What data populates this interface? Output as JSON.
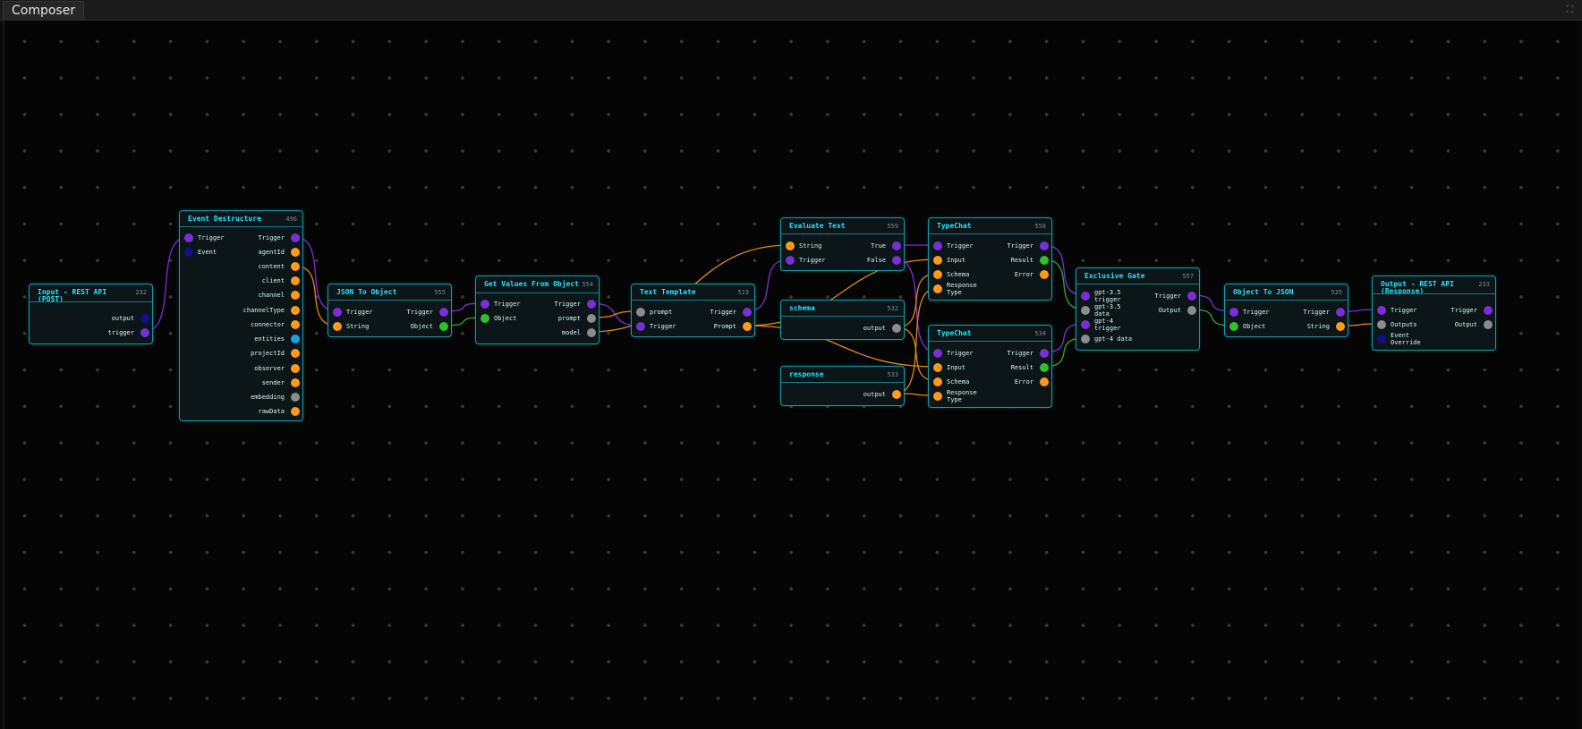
{
  "app": {
    "tab_label": "Composer",
    "maximize_icon": "expand-icon"
  },
  "colors": {
    "trigger": "#7a2fd6",
    "event": "#10108a",
    "string": "#ff9a1a",
    "object": "#2fbf2f",
    "any": "#8c8c8c",
    "entities": "#1f9fe0",
    "wire_orange": "#e08a14",
    "wire_purple": "#7a2fd6",
    "wire_green": "#2fa82f"
  },
  "nodes": [
    {
      "key": "input-rest",
      "title": "Input - REST API\n(POST)",
      "id": "232",
      "inputs": [],
      "outputs": [
        {
          "label": "output",
          "type": "event"
        },
        {
          "label": "trigger",
          "type": "trigger"
        }
      ]
    },
    {
      "key": "event-destructure",
      "title": "Event Destructure",
      "id": "496",
      "inputs": [
        {
          "label": "Trigger",
          "type": "trigger"
        },
        {
          "label": "Event",
          "type": "event"
        }
      ],
      "outputs": [
        {
          "label": "Trigger",
          "type": "trigger"
        },
        {
          "label": "agentId",
          "type": "string"
        },
        {
          "label": "content",
          "type": "string"
        },
        {
          "label": "client",
          "type": "string"
        },
        {
          "label": "channel",
          "type": "string"
        },
        {
          "label": "channelType",
          "type": "string"
        },
        {
          "label": "connector",
          "type": "string"
        },
        {
          "label": "entities",
          "type": "entities"
        },
        {
          "label": "projectId",
          "type": "string"
        },
        {
          "label": "observer",
          "type": "string"
        },
        {
          "label": "sender",
          "type": "string"
        },
        {
          "label": "embedding",
          "type": "any"
        },
        {
          "label": "rawData",
          "type": "string"
        }
      ]
    },
    {
      "key": "json-to-object",
      "title": "JSON To Object",
      "id": "555",
      "inputs": [
        {
          "label": "Trigger",
          "type": "trigger"
        },
        {
          "label": "String",
          "type": "string"
        }
      ],
      "outputs": [
        {
          "label": "Trigger",
          "type": "trigger"
        },
        {
          "label": "Object",
          "type": "object"
        }
      ]
    },
    {
      "key": "get-values",
      "title": "Get Values From Object",
      "id": "554",
      "inputs": [
        {
          "label": "Trigger",
          "type": "trigger"
        },
        {
          "label": "Object",
          "type": "object"
        }
      ],
      "outputs": [
        {
          "label": "Trigger",
          "type": "trigger"
        },
        {
          "label": "prompt",
          "type": "any"
        },
        {
          "label": "model",
          "type": "any"
        }
      ]
    },
    {
      "key": "text-template",
      "title": "Text Template",
      "id": "519",
      "inputs": [
        {
          "label": "prompt",
          "type": "any"
        },
        {
          "label": "Trigger",
          "type": "trigger"
        }
      ],
      "outputs": [
        {
          "label": "Trigger",
          "type": "trigger"
        },
        {
          "label": "Prompt",
          "type": "string"
        }
      ]
    },
    {
      "key": "evaluate-text",
      "title": "Evaluate Text",
      "id": "559",
      "inputs": [
        {
          "label": "String",
          "type": "string"
        },
        {
          "label": "Trigger",
          "type": "trigger"
        }
      ],
      "outputs": [
        {
          "label": "True",
          "type": "trigger"
        },
        {
          "label": "False",
          "type": "trigger"
        }
      ]
    },
    {
      "key": "schema",
      "title": "schema",
      "id": "532",
      "inputs": [],
      "outputs": [
        {
          "label": "output",
          "type": "any"
        }
      ]
    },
    {
      "key": "response",
      "title": "response",
      "id": "533",
      "inputs": [],
      "outputs": [
        {
          "label": "output",
          "type": "string"
        }
      ]
    },
    {
      "key": "typechat-1",
      "title": "TypeChat",
      "id": "558",
      "inputs": [
        {
          "label": "Trigger",
          "type": "trigger"
        },
        {
          "label": "Input",
          "type": "string"
        },
        {
          "label": "Schema",
          "type": "string"
        },
        {
          "label": "Response\nType",
          "type": "string"
        }
      ],
      "outputs": [
        {
          "label": "Trigger",
          "type": "trigger"
        },
        {
          "label": "Result",
          "type": "object"
        },
        {
          "label": "Error",
          "type": "string"
        }
      ]
    },
    {
      "key": "typechat-2",
      "title": "TypeChat",
      "id": "534",
      "inputs": [
        {
          "label": "Trigger",
          "type": "trigger"
        },
        {
          "label": "Input",
          "type": "string"
        },
        {
          "label": "Schema",
          "type": "string"
        },
        {
          "label": "Response\nType",
          "type": "string"
        }
      ],
      "outputs": [
        {
          "label": "Trigger",
          "type": "trigger"
        },
        {
          "label": "Result",
          "type": "object"
        },
        {
          "label": "Error",
          "type": "string"
        }
      ]
    },
    {
      "key": "exclusive-gate",
      "title": "Exclusive Gate",
      "id": "557",
      "inputs": [
        {
          "label": "gpt-3.5\ntrigger",
          "type": "trigger"
        },
        {
          "label": "gpt-3.5\ndata",
          "type": "any"
        },
        {
          "label": "gpt-4\ntrigger",
          "type": "trigger"
        },
        {
          "label": "gpt-4 data",
          "type": "any"
        }
      ],
      "outputs": [
        {
          "label": "Trigger",
          "type": "trigger"
        },
        {
          "label": "Output",
          "type": "any"
        }
      ]
    },
    {
      "key": "object-to-json",
      "title": "Object To JSON",
      "id": "535",
      "inputs": [
        {
          "label": "Trigger",
          "type": "trigger"
        },
        {
          "label": "Object",
          "type": "object"
        }
      ],
      "outputs": [
        {
          "label": "Trigger",
          "type": "trigger"
        },
        {
          "label": "String",
          "type": "string"
        }
      ]
    },
    {
      "key": "output-rest",
      "title": "Output - REST API\n(Response)",
      "id": "233",
      "inputs": [
        {
          "label": "Trigger",
          "type": "trigger"
        },
        {
          "label": "Outputs",
          "type": "any"
        },
        {
          "label": "Event\nOverride",
          "type": "event"
        }
      ],
      "outputs": [
        {
          "label": "Trigger",
          "type": "trigger"
        },
        {
          "label": "Output",
          "type": "any"
        }
      ]
    }
  ],
  "wires": [
    {
      "from": "input-rest.out.1",
      "to": "event-destructure.in.0",
      "color": "wire_purple"
    },
    {
      "from": "event-destructure.out.0",
      "to": "json-to-object.in.0",
      "color": "wire_purple"
    },
    {
      "from": "event-destructure.out.2",
      "to": "json-to-object.in.1",
      "color": "wire_orange"
    },
    {
      "from": "json-to-object.out.0",
      "to": "get-values.in.0",
      "color": "wire_purple"
    },
    {
      "from": "json-to-object.out.1",
      "to": "get-values.in.1",
      "color": "wire_green"
    },
    {
      "from": "get-values.out.0",
      "to": "text-template.in.1",
      "color": "wire_purple"
    },
    {
      "from": "get-values.out.1",
      "to": "text-template.in.0",
      "color": "wire_orange"
    },
    {
      "from": "get-values.out.2",
      "to": "evaluate-text.in.0",
      "color": "wire_orange"
    },
    {
      "from": "text-template.out.0",
      "to": "evaluate-text.in.1",
      "color": "wire_purple"
    },
    {
      "from": "text-template.out.1",
      "to": "typechat-1.in.1",
      "color": "wire_orange"
    },
    {
      "from": "text-template.out.1",
      "to": "typechat-2.in.1",
      "color": "wire_orange"
    },
    {
      "from": "evaluate-text.out.0",
      "to": "typechat-1.in.0",
      "color": "wire_purple"
    },
    {
      "from": "evaluate-text.out.1",
      "to": "typechat-2.in.0",
      "color": "wire_purple"
    },
    {
      "from": "schema.out.0",
      "to": "typechat-1.in.2",
      "color": "wire_orange"
    },
    {
      "from": "schema.out.0",
      "to": "typechat-2.in.2",
      "color": "wire_orange"
    },
    {
      "from": "response.out.0",
      "to": "typechat-1.in.3",
      "color": "wire_orange"
    },
    {
      "from": "response.out.0",
      "to": "typechat-2.in.3",
      "color": "wire_orange"
    },
    {
      "from": "typechat-1.out.0",
      "to": "exclusive-gate.in.0",
      "color": "wire_purple"
    },
    {
      "from": "typechat-1.out.1",
      "to": "exclusive-gate.in.1",
      "color": "wire_green"
    },
    {
      "from": "typechat-2.out.0",
      "to": "exclusive-gate.in.2",
      "color": "wire_purple"
    },
    {
      "from": "typechat-2.out.1",
      "to": "exclusive-gate.in.3",
      "color": "wire_green"
    },
    {
      "from": "exclusive-gate.out.0",
      "to": "object-to-json.in.0",
      "color": "wire_purple"
    },
    {
      "from": "exclusive-gate.out.1",
      "to": "object-to-json.in.1",
      "color": "wire_green"
    },
    {
      "from": "object-to-json.out.0",
      "to": "output-rest.in.0",
      "color": "wire_purple"
    },
    {
      "from": "object-to-json.out.1",
      "to": "output-rest.in.1",
      "color": "wire_orange"
    }
  ]
}
